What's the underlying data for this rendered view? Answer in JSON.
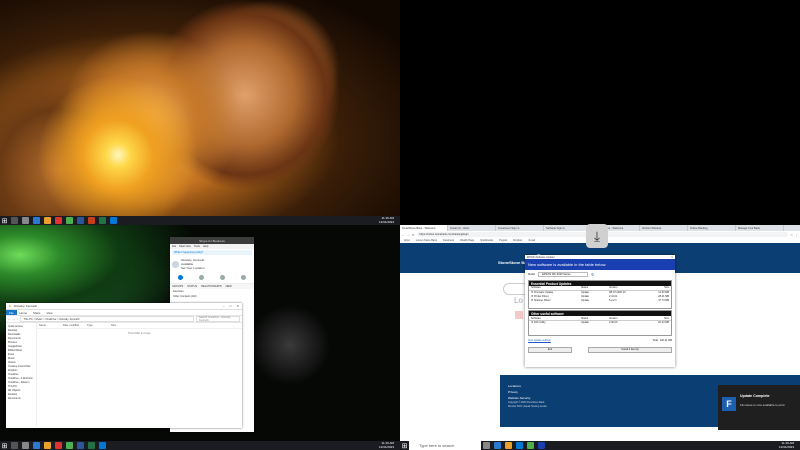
{
  "top_left": {
    "taskbar": {
      "clock_time": "11:16 AM",
      "clock_date": "12/31/2023"
    }
  },
  "bottom_left": {
    "skype": {
      "title": "Skype for Business",
      "menu": [
        "File",
        "Meet Now",
        "Tools",
        "Help"
      ],
      "mood": "What's happening today?",
      "user_name": "Glovsky, Kenneth",
      "user_status": "Available",
      "user_location": "Set Your Location",
      "sub_tabs": [
        "GROUPS",
        "STATUS",
        "RELATIONSHIPS",
        "NEW"
      ],
      "list": [
        "Favorites",
        "Other Contacts (0/2)"
      ]
    },
    "explorer": {
      "title": "Glovsky, Kenneth",
      "ribbon": [
        "File",
        "Home",
        "Share",
        "View"
      ],
      "path": "This PC > Music > OneDrive > Glovsky, Kenneth",
      "search_placeholder": "Search OneDrive - Glovsky, Kenneth",
      "nav": [
        "Quick access",
        "Desktop",
        "Downloads",
        "Documents",
        "Pictures",
        "GoogleDrive",
        "EWAonScan",
        "Excel",
        "Music",
        "Videos",
        "Creative Cloud Files",
        "Dropbox",
        "OneDrive",
        "OneDrive - A.Morrison",
        "OneDrive - Ravenn",
        "This PC",
        "3D Objects",
        "Desktop",
        "Documents"
      ],
      "columns": [
        "Name",
        "Date modified",
        "Type",
        "Size"
      ],
      "empty_text": "This folder is empty."
    },
    "taskbar": {
      "clock_time": "11:16 AM",
      "clock_date": "12/31/2023"
    }
  },
  "bottom_right": {
    "browser": {
      "tabs": [
        "SmartStone Bank - Welcome",
        "Gmail (2) - Inbox",
        "Investment Sign in",
        "NetSuite Sign In",
        "Wealth Online - Welcome",
        "Verizon Wireless",
        "Online Banking",
        "Manage Your Bank",
        "Update Account"
      ],
      "url": "https://online.stonebank.com/banking/login",
      "bookmarks": [
        "Apps",
        "Lumen Stone Bank",
        "Facebook",
        "Wealth Page",
        "Quickbooks",
        "Paypal",
        "Dropbox",
        "Gmail",
        "GoogleDrive",
        "Bookmarks"
      ]
    },
    "bank": {
      "logo": "StoneStone Bank",
      "login_label": "Lo",
      "footer": [
        "Locations",
        "Privacy",
        "Website Security"
      ],
      "footer_copyright": "Copyright © 2020 StoneStone Bank",
      "footer_member": "Member FDIC | Equal Housing Lender"
    },
    "updater": {
      "window_title": "EPSON Software Updater",
      "banner": "New software is available in the table below.",
      "model_label": "Model",
      "model_value": "EPSON WF-3640 Series",
      "essential_title": "Essential Product Updates",
      "useful_title": "Other useful software",
      "col_headers": [
        "Software",
        "Status",
        "Version",
        "Size"
      ],
      "essential_rows": [
        {
          "software": "Firmware Update",
          "status": "Update",
          "version": "AB 07.2020.10",
          "size": "14.53 MB"
        },
        {
          "software": "Printer Driver",
          "status": "Update",
          "version": "2.41.01",
          "size": "28.01 MB"
        },
        {
          "software": "Scanner Driver",
          "status": "Update",
          "version": "5.2.2.1",
          "size": "37.74 MB"
        }
      ],
      "useful_rows": [
        {
          "software": "FAX Utility",
          "status": "Update",
          "version": "2.00.00",
          "size": "20.23 MB"
        }
      ],
      "auto_update_link": "Auto update settings",
      "total": "Total :  100.21 MB",
      "exit_label": "Exit",
      "install_label": "Install 4 item(s)"
    },
    "toast": {
      "title": "Update Complete",
      "body": "Firmware is now available to print."
    },
    "taskbar": {
      "search_placeholder": "Type here to search",
      "clock_time": "11:16 AM",
      "clock_date": "12/31/2023"
    }
  }
}
